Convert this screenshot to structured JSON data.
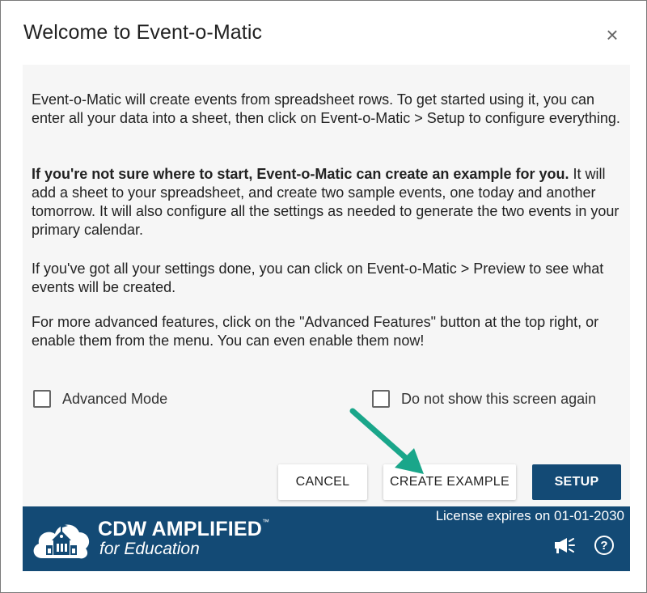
{
  "dialog": {
    "title": "Welcome to Event-o-Matic",
    "close_glyph": "×"
  },
  "content": {
    "p1": "Event-o-Matic will create events from spreadsheet rows. To get started using it, you can enter all your data into a sheet, then click on Event-o-Matic > Setup to configure everything.",
    "p2_bold": "If you're not sure where to start, Event-o-Matic can create an example for you.",
    "p2_rest": " It will add a sheet to your spreadsheet, and create two sample events, one today and another tomorrow. It will also configure all the settings as needed to generate the two events in your primary calendar.",
    "p3": "If you've got all your settings done, you can click on Event-o-Matic > Preview to see what events will be created.",
    "p4": "For more advanced features, click on the \"Advanced Features\" button at the top right, or enable them from the menu. You can even enable them now!"
  },
  "checkboxes": {
    "advanced_mode": {
      "label": "Advanced Mode",
      "checked": false
    },
    "do_not_show": {
      "label": "Do not show this screen again",
      "checked": false
    }
  },
  "buttons": {
    "cancel": "CANCEL",
    "create_example": "CREATE EXAMPLE",
    "setup": "SETUP"
  },
  "footer": {
    "brand": "CDW AMPLIFIED",
    "brand_tm": "™",
    "brand_sub": "for Education",
    "license": "License expires on 01-01-2030",
    "help_glyph": "?"
  },
  "colors": {
    "accent_navy": "#134a75",
    "arrow_teal": "#1aa68a",
    "content_bg": "#f6f6f6"
  },
  "icons": [
    "close-icon",
    "cloud-school-logo-icon",
    "megaphone-icon",
    "help-icon",
    "annotation-arrow"
  ]
}
